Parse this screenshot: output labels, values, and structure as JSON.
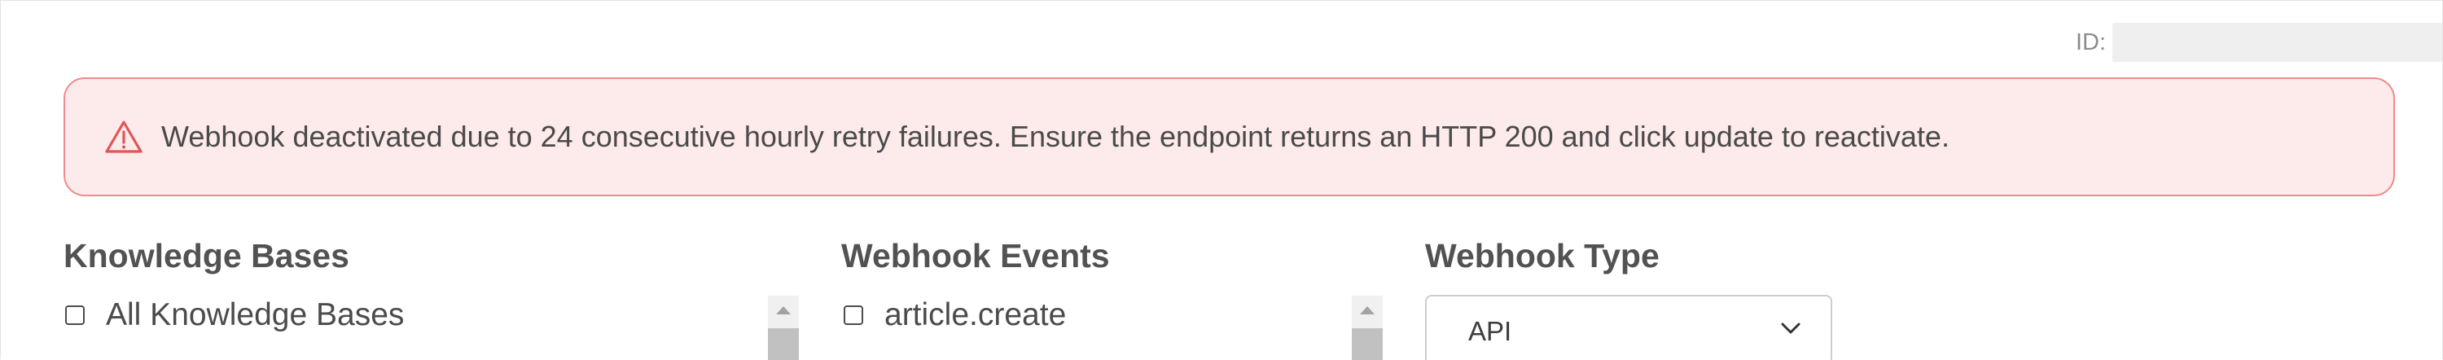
{
  "header": {
    "id_label": "ID:"
  },
  "alert": {
    "icon": "warning-triangle-icon",
    "message": "Webhook deactivated due to 24 consecutive hourly retry failures. Ensure the endpoint returns an HTTP 200 and click update to reactivate.",
    "colors": {
      "background": "#fdeaea",
      "border": "#ee8a8a",
      "icon": "#e05555"
    }
  },
  "knowledge_bases": {
    "title": "Knowledge Bases",
    "items": [
      {
        "label": "All Knowledge Bases",
        "checked": false
      }
    ]
  },
  "webhook_events": {
    "title": "Webhook Events",
    "items": [
      {
        "label": "article.create",
        "checked": false
      }
    ]
  },
  "webhook_type": {
    "title": "Webhook Type",
    "selected": "API",
    "icon": "chevron-down-icon"
  }
}
